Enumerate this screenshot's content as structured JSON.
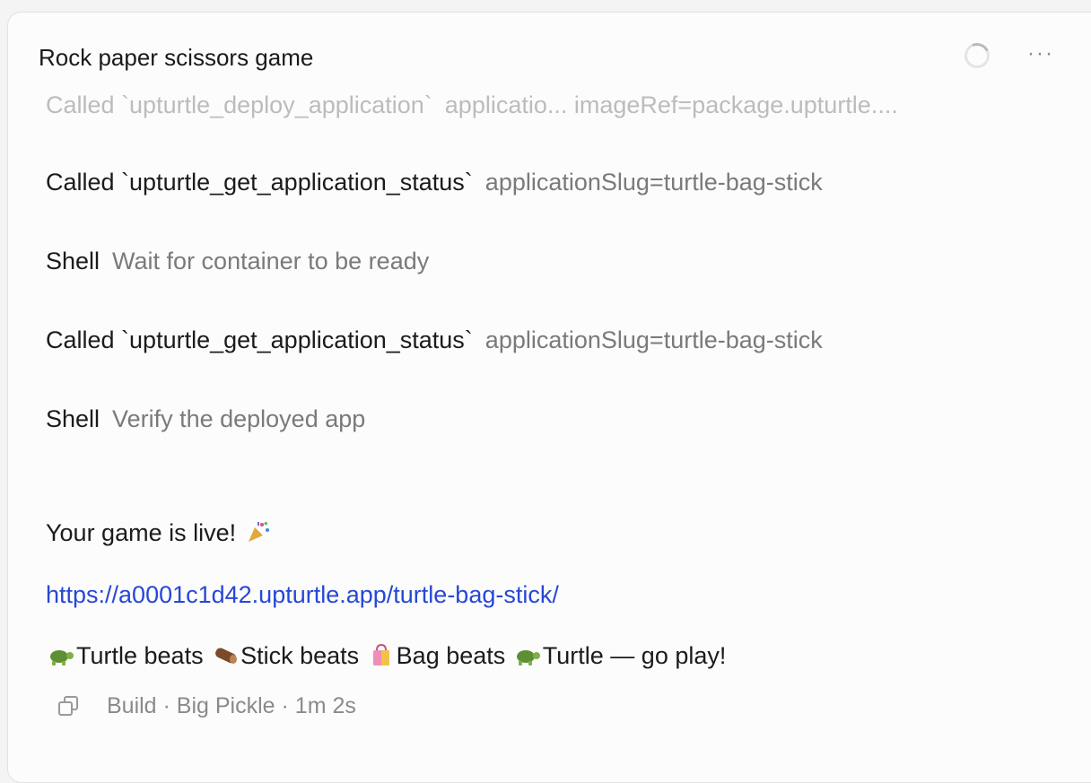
{
  "header": {
    "title": "Rock paper scissors game",
    "more_label": "···"
  },
  "log": [
    {
      "kind": "Called `upturtle_deploy_application`",
      "detail": "applicatio...   imageRef=package.upturtle...."
    },
    {
      "kind": "Called `upturtle_get_application_status`",
      "detail": "applicationSlug=turtle-bag-stick"
    },
    {
      "kind": "Shell",
      "detail": "Wait for container to be ready"
    },
    {
      "kind": "Called `upturtle_get_application_status`",
      "detail": "applicationSlug=turtle-bag-stick"
    },
    {
      "kind": "Shell",
      "detail": "Verify the deployed app"
    }
  ],
  "message": {
    "live_text": "Your game is live!",
    "link": "https://a0001c1d42.upturtle.app/turtle-bag-stick/",
    "rules": {
      "p1": "Turtle beats",
      "p2": "Stick beats",
      "p3": "Bag beats",
      "p4": "Turtle — go play!"
    }
  },
  "footer": {
    "meta": "Build · Big Pickle · 1m 2s"
  }
}
